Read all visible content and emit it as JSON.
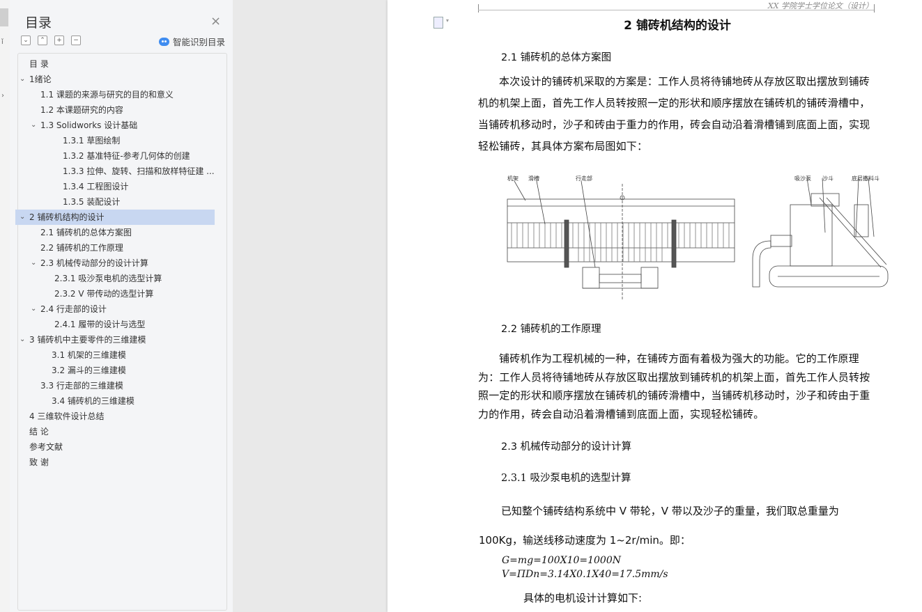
{
  "nav": {
    "title": "目录",
    "close_icon": "×",
    "tools": [
      "⌄",
      "⌃",
      "+",
      "−"
    ],
    "smart_label": "智能识别目录",
    "items": [
      {
        "label": "目 录",
        "level": 0,
        "chev": ""
      },
      {
        "label": "1绪论",
        "level": 0,
        "chev": "⌄"
      },
      {
        "label": "1.1 课题的来源与研究的目的和意义",
        "level": 1,
        "chev": ""
      },
      {
        "label": "1.2 本课题研究的内容",
        "level": 1,
        "chev": ""
      },
      {
        "label": "1.3 Solidworks 设计基础",
        "level": 1,
        "chev": "⌄"
      },
      {
        "label": "1.3.1  草图绘制",
        "level": 2,
        "chev": ""
      },
      {
        "label": "1.3.2  基准特征-参考几何体的创建",
        "level": 2,
        "chev": ""
      },
      {
        "label": "1.3.3 拉伸、旋转、扫描和放样特征建 ...",
        "level": 2,
        "chev": ""
      },
      {
        "label": "1.3.4 工程图设计",
        "level": 2,
        "chev": ""
      },
      {
        "label": "1.3.5 装配设计",
        "level": 2,
        "chev": ""
      },
      {
        "label": "2  铺砖机结构的设计",
        "level": 0,
        "chev": "⌄",
        "selected": true
      },
      {
        "label": "2.1  铺砖机的总体方案图",
        "level": 1,
        "chev": ""
      },
      {
        "label": "2.2  铺砖机的工作原理",
        "level": 1,
        "chev": ""
      },
      {
        "label": "2.3  机械传动部分的设计计算",
        "level": 1,
        "chev": "⌄"
      },
      {
        "label": "2.3.1 吸沙泵电机的选型计算",
        "level": 2,
        "chev": ""
      },
      {
        "label": "2.3.2 V 带传动的选型计算",
        "level": 2,
        "chev": ""
      },
      {
        "label": "2.4  行走部的设计",
        "level": 1,
        "chev": "⌄"
      },
      {
        "label": "2.4.1  履带的设计与选型",
        "level": 2,
        "chev": ""
      },
      {
        "label": "3  铺砖机中主要零件的三维建模",
        "level": 0,
        "chev": "⌄"
      },
      {
        "label": "3.1 机架的三维建模",
        "level": 2,
        "chev": ""
      },
      {
        "label": "3.2 漏斗的三维建模",
        "level": 2,
        "chev": ""
      },
      {
        "label": "3.3  行走部的三维建模",
        "level": 1,
        "chev": ""
      },
      {
        "label": "3.4 铺砖机的三维建模",
        "level": 2,
        "chev": ""
      },
      {
        "label": "4  三维软件设计总结",
        "level": 0,
        "chev": ""
      },
      {
        "label": "结    论",
        "level": 0,
        "chev": ""
      },
      {
        "label": "参考文献",
        "level": 0,
        "chev": ""
      },
      {
        "label": "致    谢",
        "level": 0,
        "chev": ""
      }
    ]
  },
  "doc": {
    "header_text": "XX 学院学士学位论文（设计）",
    "chapter_title": "2  铺砖机结构的设计",
    "s21_title": "2.1  铺砖机的总体方案图",
    "s21_para": "本次设计的铺砖机采取的方案是：工作人员将待铺地砖从存放区取出摆放到铺砖机的机架上面，首先工作人员转按照一定的形状和顺序摆放在铺砖机的铺砖滑槽中，当铺砖机移动时，沙子和砖由于重力的作用，砖会自动沿着滑槽铺到底面上面，实现轻松铺砖，其具体方案布局图如下：",
    "fig_labels": {
      "frame": "机架",
      "chute": "滑槽",
      "walker": "行走部",
      "pump": "吸沙泵",
      "hopper": "沙斗",
      "spreader": "底层撒料斗"
    },
    "s22_title": "2.2  铺砖机的工作原理",
    "s22_para": "铺砖机作为工程机械的一种，在铺砖方面有着极为强大的功能。它的工作原理为：工作人员将待铺地砖从存放区取出摆放到铺砖机的机架上面，首先工作人员转按照一定的形状和顺序摆放在铺砖机的铺砖滑槽中，当铺砖机移动时，沙子和砖由于重力的作用，砖会自动沿着滑槽铺到底面上面，实现轻松铺砖。",
    "s23_title": "2.3  机械传动部分的设计计算",
    "s231_title": "2.3.1 吸沙泵电机的选型计算",
    "line1": "已知整个铺砖结构系统中 V 带轮，V 带以及沙子的重量，我们取总重量为",
    "line2": "100Kg，输送线移动速度为 1~2r/min。即：",
    "formula1": "G=mg=100X10=1000N",
    "formula2": "V=ΠDn=3.14X0.1X40=17.5mm/s",
    "line3": "具体的电机设计计算如下:"
  }
}
